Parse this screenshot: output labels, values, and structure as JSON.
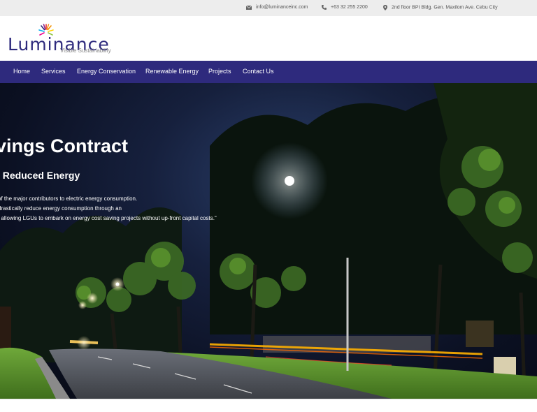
{
  "topbar": {
    "email": "info@luminanceinc.com",
    "phone": "+63 32 255 2200",
    "address": "2nd floor BPI Bldg. Gen. Maxilom Ave. Cebu City"
  },
  "logo": {
    "name": "Luminance",
    "tagline": "Visible Sustainability"
  },
  "nav": {
    "items": [
      "Home",
      "Services",
      "Energy Conservation",
      "Renewable Energy",
      "Projects",
      "Contact Us"
    ]
  },
  "hero": {
    "title": "vings Contract",
    "subtitle": ", Reduced Energy",
    "lines": [
      "of the major contributors to electric energy consumption.",
      "drastically reduce energy consumption through an",
      ", allowing LGUs to embark on energy cost saving projects without up-front capital costs.\""
    ]
  },
  "colors": {
    "brand": "#2e2a7d",
    "topbar": "#ededed"
  }
}
